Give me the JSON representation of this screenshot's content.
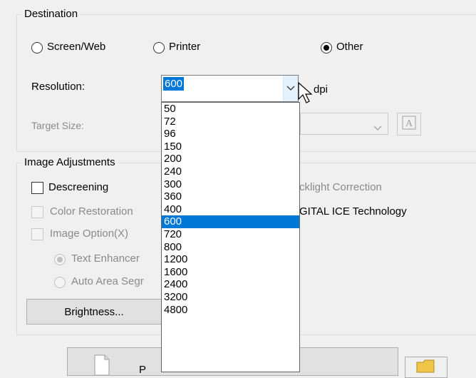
{
  "destination": {
    "label": "Destination",
    "radios": [
      {
        "label": "Screen/Web",
        "checked": false
      },
      {
        "label": "Printer",
        "checked": false
      },
      {
        "label": "Other",
        "checked": true
      }
    ],
    "resolution_label": "Resolution:",
    "resolution_value": "600",
    "dpi_label": "dpi",
    "target_size_label": "Target Size:"
  },
  "resolution_options": [
    "50",
    "72",
    "96",
    "150",
    "200",
    "240",
    "300",
    "360",
    "400",
    "600",
    "720",
    "800",
    "1200",
    "1600",
    "2400",
    "3200",
    "4800"
  ],
  "selected_option": "600",
  "image_adjustments": {
    "label": "Image Adjustments",
    "descreening": "Descreening",
    "color_restoration": "Color Restoration",
    "image_option": "Image Option(X)",
    "text_enhancement": "Text Enhancer",
    "auto_area": "Auto Area Segr",
    "backlight": "cklight Correction",
    "digital_ice": "GITAL ICE Technology",
    "brightness_button": "Brightness..."
  },
  "bottom_button_text": "P"
}
